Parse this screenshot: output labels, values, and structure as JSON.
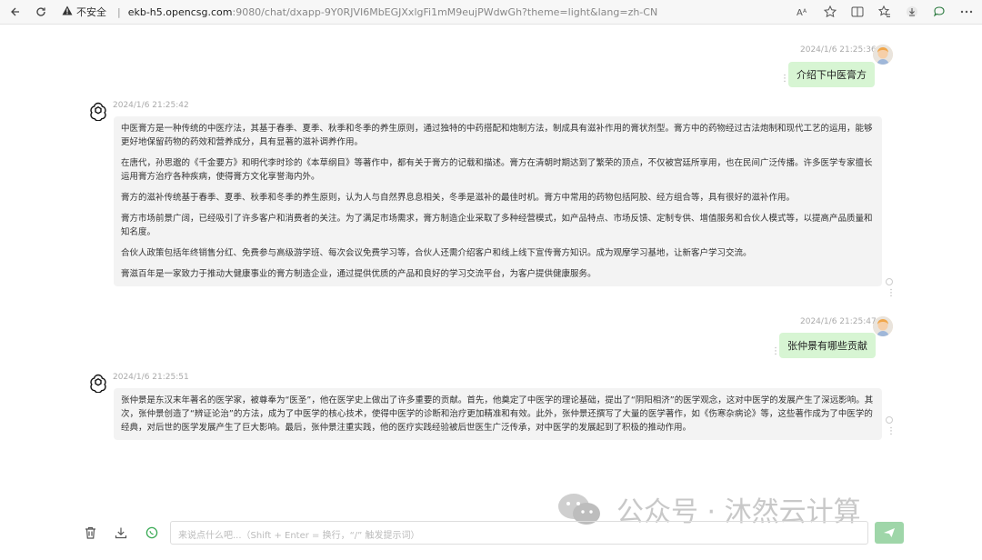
{
  "browser": {
    "security_label": "不安全",
    "url_host": "ekb-h5.opencsg.com",
    "url_path": ":9080/chat/dxapp-9Y0RJVI6MbEGJXxlgFi1mM9eujPWdwGh?theme=light&lang=zh-CN"
  },
  "messages": [
    {
      "role": "user",
      "timestamp": "2024/1/6 21:25:36",
      "text": "介绍下中医膏方"
    },
    {
      "role": "assistant",
      "timestamp": "2024/1/6 21:25:42",
      "paragraphs": [
        "中医膏方是一种传统的中医疗法，其基于春季、夏季、秋季和冬季的养生原则，通过独特的中药搭配和炮制方法，制成具有滋补作用的膏状剂型。膏方中的药物经过古法炮制和现代工艺的运用，能够更好地保留药物的药效和营养成分，具有显著的滋补调养作用。",
        "在唐代，孙思邈的《千金要方》和明代李时珍的《本草纲目》等著作中，都有关于膏方的记载和描述。膏方在清朝时期达到了繁荣的顶点，不仅被宫廷所享用，也在民间广泛传播。许多医学专家擅长运用膏方治疗各种疾病，使得膏方文化享誉海内外。",
        "膏方的滋补传统基于春季、夏季、秋季和冬季的养生原则，认为人与自然界息息相关，冬季是滋补的最佳时机。膏方中常用的药物包括阿胶、经方组合等，具有很好的滋补作用。",
        "膏方市场前景广阔，已经吸引了许多客户和消费者的关注。为了满足市场需求，膏方制造企业采取了多种经营模式，如产品特点、市场反馈、定制专供、增值服务和合伙人模式等，以提高产品质量和知名度。",
        "合伙人政策包括年终销售分红、免费参与高级游学班、每次会议免费学习等，合伙人还需介绍客户和线上线下宣传膏方知识。成为观摩学习基地，让新客户学习交流。",
        "膏滋百年是一家致力于推动大健康事业的膏方制造企业，通过提供优质的产品和良好的学习交流平台，为客户提供健康服务。"
      ]
    },
    {
      "role": "user",
      "timestamp": "2024/1/6 21:25:47",
      "text": "张仲景有哪些贡献"
    },
    {
      "role": "assistant",
      "timestamp": "2024/1/6 21:25:51",
      "paragraphs": [
        "张仲景是东汉末年著名的医学家，被尊奉为“医圣”，他在医学史上做出了许多重要的贡献。首先，他奠定了中医学的理论基础，提出了“阴阳相济”的医学观念，这对中医学的发展产生了深远影响。其次，张仲景创造了“辨证论治”的方法，成为了中医学的核心技术，使得中医学的诊断和治疗更加精准和有效。此外，张仲景还撰写了大量的医学著作，如《伤寒杂病论》等，这些著作成为了中医学的经典，对后世的医学发展产生了巨大影响。最后，张仲景注重实践，他的医疗实践经验被后世医生广泛传承，对中医学的发展起到了积极的推动作用。"
      ]
    }
  ],
  "watermark": {
    "text": "公众号 · 沐然云计算"
  },
  "input": {
    "placeholder": "来说点什么吧...（Shift + Enter = 换行，“/” 触发提示词）",
    "value": ""
  },
  "icons": {
    "trash": "trash-icon",
    "download": "download-icon",
    "whatsapp": "whatsapp-icon",
    "send": "send-icon"
  }
}
